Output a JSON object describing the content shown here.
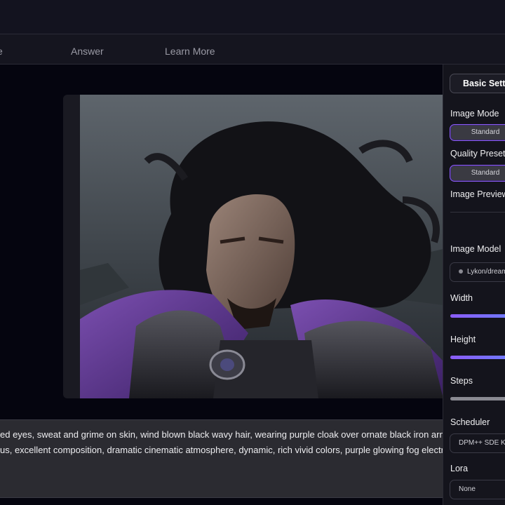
{
  "tabs": [
    {
      "label": "e"
    },
    {
      "label": "Answer"
    },
    {
      "label": "Learn More"
    }
  ],
  "prompt": {
    "line1": "ed eyes, sweat and grime on skin, wind blown black wavy hair, wearing purple cloak over ornate black iron armor",
    "line2": "us, excellent composition, dramatic cinematic atmosphere, dynamic, rich vivid colors, purple glowing fog electric"
  },
  "settings": {
    "title": "Basic Settings",
    "image_mode_label": "Image Mode",
    "image_mode_value": "Standard",
    "quality_label": "Quality Presets",
    "quality_value": "Standard",
    "preview_label": "Image Preview",
    "model_label": "Image Model",
    "model_value": "Lykon/dreamshaper",
    "width_label": "Width",
    "height_label": "Height",
    "steps_label": "Steps",
    "scheduler_label": "Scheduler",
    "scheduler_value": "DPM++ SDE Karras",
    "lora_label": "Lora",
    "lora_value": "None"
  },
  "sliders": {
    "width": 1.0,
    "height": 1.0,
    "steps": 1.0
  },
  "colors": {
    "accent": "#8b5cf6",
    "slider": "#6d7cff"
  },
  "icons": {
    "model_status": "dot-icon"
  }
}
